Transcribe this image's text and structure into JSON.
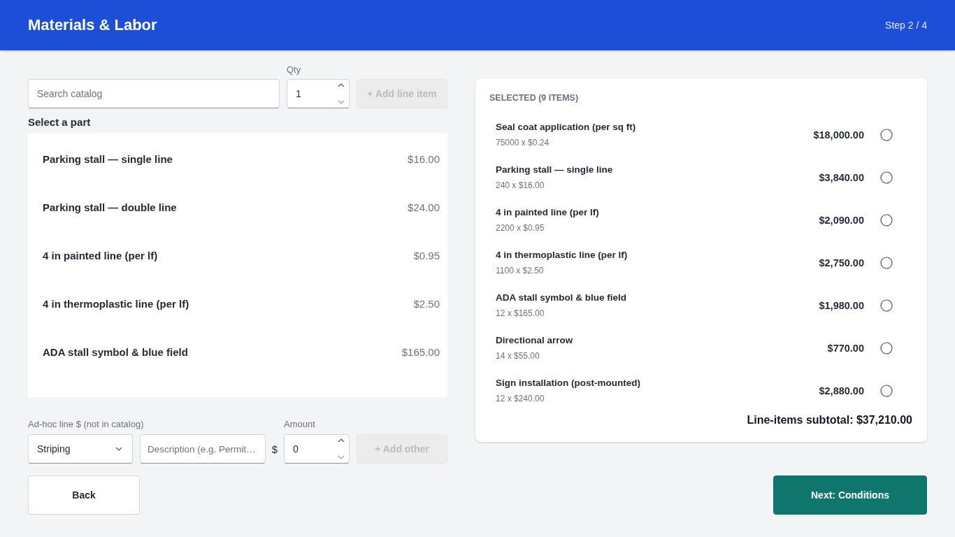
{
  "header": {
    "title": "Materials & Labor",
    "step": "Step 2 / 4"
  },
  "catalog": {
    "search": {
      "placeholder": "Search catalog"
    },
    "qty": {
      "label": "Qty",
      "value": "1"
    },
    "add_button": {
      "label": "+ Add line item",
      "disabled": true
    },
    "heading": "Select a part",
    "parts": [
      {
        "name": "Parking stall — single line",
        "price": "$16.00"
      },
      {
        "name": "Parking stall — double line",
        "price": "$24.00"
      },
      {
        "name": "4 in painted line (per lf)",
        "price": "$0.95"
      },
      {
        "name": "4 in thermoplastic line (per lf)",
        "price": "$2.50"
      },
      {
        "name": "ADA stall symbol & blue field",
        "price": "$165.00"
      }
    ]
  },
  "adhoc": {
    "label": "Ad-hoc line $ (not in catalog)",
    "category": {
      "value": "Striping"
    },
    "description": {
      "placeholder": "Description (e.g. Permit…"
    },
    "currency": "$",
    "amount": {
      "label": "Amount",
      "value": "0"
    },
    "add_button": {
      "label": "+ Add other",
      "disabled": true
    }
  },
  "selected": {
    "heading": "SELECTED (9 ITEMS)",
    "items": [
      {
        "name": "Seal coat application (per sq ft)",
        "detail": "75000 x $0.24",
        "amount": "$18,000.00",
        "checked": false
      },
      {
        "name": "Parking stall — single line",
        "detail": "240 x $16.00",
        "amount": "$3,840.00",
        "checked": false
      },
      {
        "name": "4 in painted line (per lf)",
        "detail": "2200 x $0.95",
        "amount": "$2,090.00",
        "checked": false
      },
      {
        "name": "4 in thermoplastic line (per lf)",
        "detail": "1100 x $2.50",
        "amount": "$2,750.00",
        "checked": false
      },
      {
        "name": "ADA stall symbol & blue field",
        "detail": "12 x $165.00",
        "amount": "$1,980.00",
        "checked": false
      },
      {
        "name": "Directional arrow",
        "detail": "14 x $55.00",
        "amount": "$770.00",
        "checked": false
      },
      {
        "name": "Sign installation (post-mounted)",
        "detail": "12 x $240.00",
        "amount": "$2,880.00",
        "checked": false
      }
    ],
    "subtotal": "Line-items subtotal: $37,210.00"
  },
  "footer": {
    "back": "Back",
    "next": "Next: Conditions"
  }
}
